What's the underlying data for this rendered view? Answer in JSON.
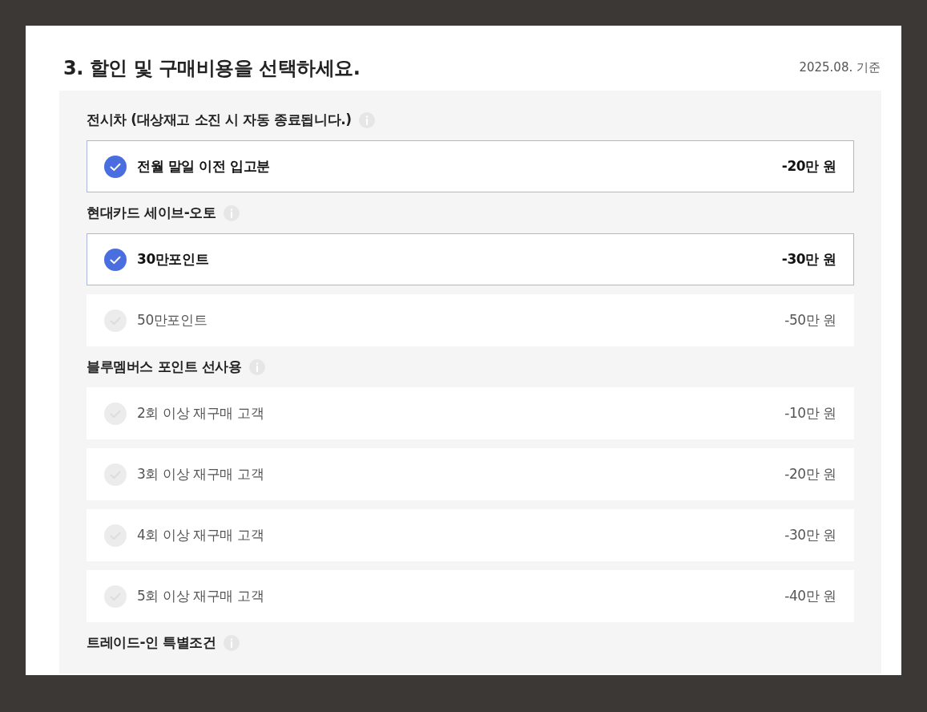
{
  "title": "3. 할인 및 구매비용을 선택하세요.",
  "as_of": "2025.08. 기준",
  "groups": [
    {
      "heading": "전시차 (대상재고 소진 시 자동 종료됩니다.)",
      "options": [
        {
          "label": "전월 말일 이전 입고분",
          "amount": "-20만 원",
          "selected": true
        }
      ]
    },
    {
      "heading": "현대카드 세이브-오토",
      "options": [
        {
          "label": "30만포인트",
          "amount": "-30만 원",
          "selected": true
        },
        {
          "label": "50만포인트",
          "amount": "-50만 원",
          "selected": false
        }
      ]
    },
    {
      "heading": "블루멤버스 포인트 선사용",
      "options": [
        {
          "label": "2회 이상 재구매 고객",
          "amount": "-10만 원",
          "selected": false
        },
        {
          "label": "3회 이상 재구매 고객",
          "amount": "-20만 원",
          "selected": false
        },
        {
          "label": "4회 이상 재구매 고객",
          "amount": "-30만 원",
          "selected": false
        },
        {
          "label": "5회 이상 재구매 고객",
          "amount": "-40만 원",
          "selected": false
        }
      ]
    },
    {
      "heading": "트레이드-인 특별조건"
    }
  ]
}
